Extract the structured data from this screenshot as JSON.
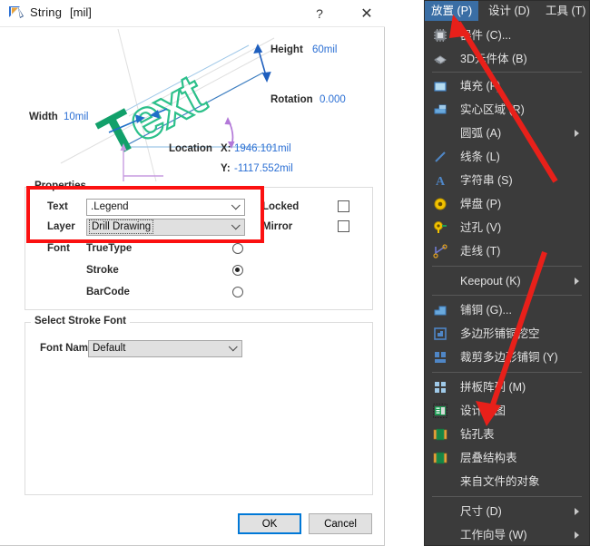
{
  "dialog": {
    "title": "String",
    "unit": "[mil]",
    "app_icon": "altium-string-icon",
    "help_label": "?",
    "close_label": "✕",
    "preview": {
      "sample_text": "Text",
      "height_label": "Height",
      "height_value": "60mil",
      "rotation_label": "Rotation",
      "rotation_value": "0.000",
      "width_label": "Width",
      "width_value": "10mil",
      "location_label": "Location",
      "location_x_label": "X:",
      "location_x_value": "1946.101mil",
      "location_y_label": "Y:",
      "location_y_value": "-1117.552mil"
    },
    "properties": {
      "group_title": "Properties",
      "text_label": "Text",
      "text_value": ".Legend",
      "layer_label": "Layer",
      "layer_value": "Drill Drawing",
      "locked_label": "Locked",
      "locked_checked": false,
      "mirror_label": "Mirror",
      "mirror_checked": false,
      "font_label": "Font",
      "font_options": [
        {
          "label": "TrueType",
          "selected": false
        },
        {
          "label": "Stroke",
          "selected": true
        },
        {
          "label": "BarCode",
          "selected": false
        }
      ]
    },
    "stroke_font": {
      "group_title": "Select Stroke Font",
      "font_name_label": "Font Name",
      "font_name_value": "Default"
    },
    "buttons": {
      "ok": "OK",
      "cancel": "Cancel"
    },
    "highlight_color": "#fb1111"
  },
  "menu": {
    "menubar": [
      {
        "label": "放置 (P)",
        "active": true
      },
      {
        "label": "设计 (D)",
        "active": false
      },
      {
        "label": "工具 (T)",
        "active": false
      }
    ],
    "accent_color": "#3a6ea5",
    "background": "#3b3b3b",
    "items": [
      {
        "label": "器件 (C)...",
        "icon": "component-icon",
        "submenu": false
      },
      {
        "label": "3D元件体 (B)",
        "icon": "body3d-icon",
        "submenu": false
      },
      {
        "sep": true
      },
      {
        "label": "填充 (F)",
        "icon": "fill-icon",
        "submenu": false
      },
      {
        "label": "实心区域 (R)",
        "icon": "solid-region-icon",
        "submenu": false
      },
      {
        "label": "圆弧 (A)",
        "icon": "none",
        "submenu": true
      },
      {
        "label": "线条 (L)",
        "icon": "line-icon",
        "submenu": false
      },
      {
        "label": "字符串 (S)",
        "icon": "string-icon",
        "submenu": false
      },
      {
        "label": "焊盘 (P)",
        "icon": "pad-icon",
        "submenu": false
      },
      {
        "label": "过孔 (V)",
        "icon": "via-icon",
        "submenu": false
      },
      {
        "label": "走线 (T)",
        "icon": "track-icon",
        "submenu": false
      },
      {
        "sep": true
      },
      {
        "label": "Keepout (K)",
        "icon": "none",
        "submenu": true
      },
      {
        "sep": true
      },
      {
        "label": "铺铜 (G)...",
        "icon": "polygon-pour-icon",
        "submenu": false
      },
      {
        "label": "多边形铺铜挖空",
        "icon": "polygon-cutout-icon",
        "submenu": false
      },
      {
        "label": "裁剪多边形铺铜 (Y)",
        "icon": "polygon-slice-icon",
        "submenu": false
      },
      {
        "sep": true
      },
      {
        "label": "拼板阵列 (M)",
        "icon": "panel-array-icon",
        "submenu": false
      },
      {
        "label": "设计视图",
        "icon": "design-view-icon",
        "submenu": false
      },
      {
        "label": "钻孔表",
        "icon": "drill-table-icon",
        "submenu": false
      },
      {
        "label": "层叠结构表",
        "icon": "layer-stack-table-icon",
        "submenu": false
      },
      {
        "label": "来自文件的对象",
        "icon": "none",
        "submenu": false
      },
      {
        "sep": true
      },
      {
        "label": "尺寸 (D)",
        "icon": "none",
        "submenu": true
      },
      {
        "label": "工作向导 (W)",
        "icon": "none",
        "submenu": true
      }
    ]
  },
  "annotations": {
    "arrow_color": "#e8201a",
    "arrow_count": 2,
    "arrow1_target": "放置 (P)",
    "arrow2_target": "钻孔表"
  }
}
